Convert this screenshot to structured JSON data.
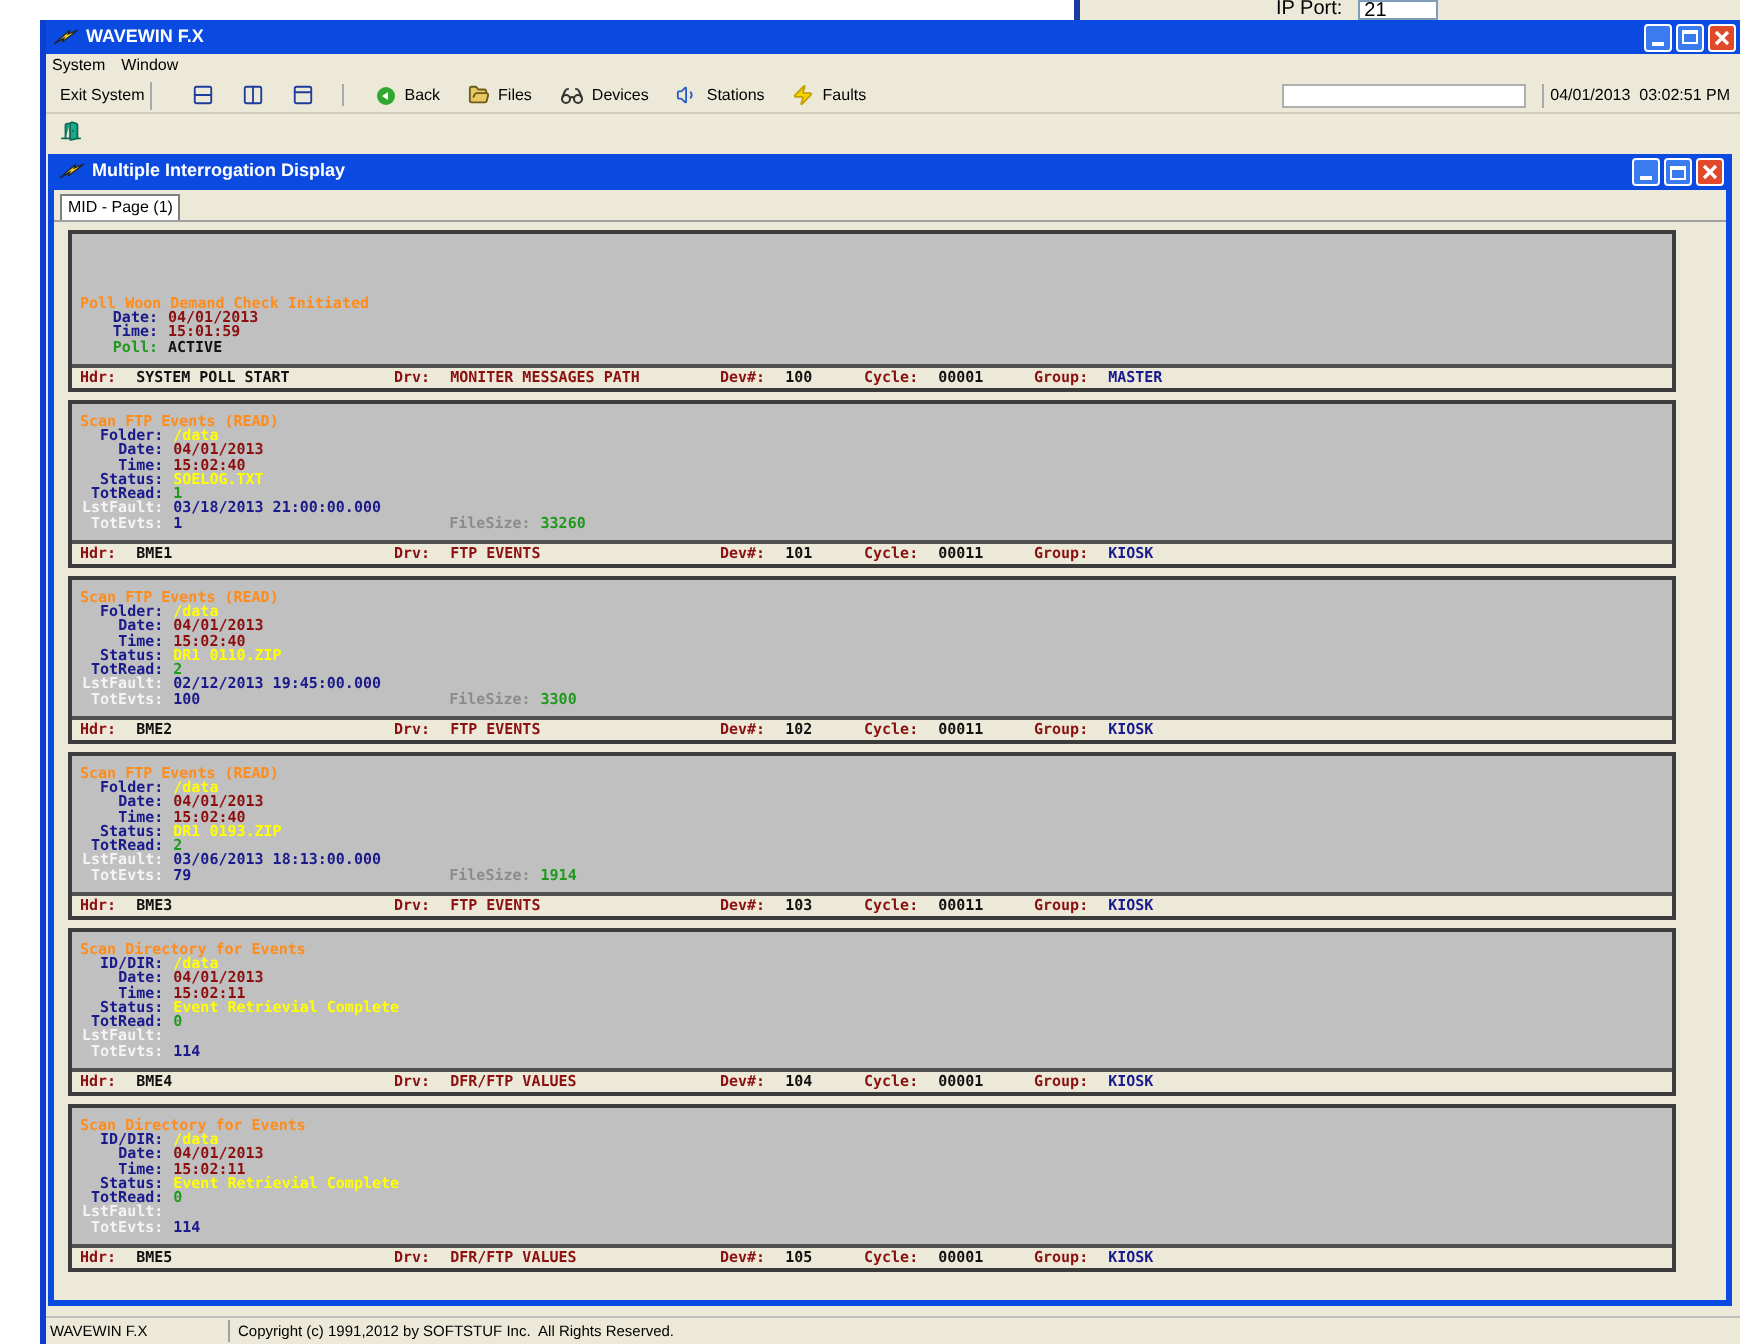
{
  "background_window": {
    "label": "IP Port:",
    "value": "21"
  },
  "window": {
    "title": "WAVEWIN F.X"
  },
  "menu": [
    "System",
    "Window"
  ],
  "toolbar": {
    "exit": "Exit System",
    "nav": [
      {
        "kind": "back",
        "label": "Back"
      },
      {
        "kind": "files",
        "label": "Files"
      },
      {
        "kind": "devices",
        "label": "Devices"
      },
      {
        "kind": "stations",
        "label": "Stations"
      },
      {
        "kind": "faults",
        "label": "Faults"
      }
    ],
    "datetime": "04/01/2013  03:02:51 PM"
  },
  "child_window": {
    "title": "Multiple Interrogation Display",
    "tabs": [
      {
        "label": "MID - Page (1)",
        "selected": true
      }
    ]
  },
  "panels": [
    {
      "title": "Poll Woon Demand Check Initiated",
      "fields": [
        {
          "kind": "timestamp",
          "label": "Date:",
          "value": "04/01/2013"
        },
        {
          "kind": "timestamp",
          "label": "Time:",
          "value": "15:01:59"
        },
        {
          "kind": "poll",
          "label": "Poll:",
          "value": "ACTIVE"
        }
      ],
      "footer": [
        {
          "label": "Hdr:",
          "value": "SYSTEM POLL START"
        },
        {
          "label": "Drv:",
          "value": "MONITER MESSAGES PATH"
        },
        {
          "label": "Dev#:",
          "value": "100"
        },
        {
          "label": "Cycle:",
          "value": "00001"
        },
        {
          "label": "Group:",
          "value": "MASTER"
        }
      ]
    },
    {
      "title": "Scan FTP Events (READ)",
      "fields": [
        {
          "kind": "path",
          "label": "Folder:",
          "value": "/data"
        },
        {
          "kind": "timestamp",
          "label": "Date:",
          "value": "04/01/2013"
        },
        {
          "kind": "timestamp",
          "label": "Time:",
          "value": "15:02:40"
        },
        {
          "kind": "status",
          "label": "Status:",
          "value": "SOELOG.TXT"
        },
        {
          "kind": "read",
          "label": "TotRead:",
          "value": "1"
        },
        {
          "kind": "fault",
          "label": "LstFault:",
          "value": "03/18/2013 21:00:00.000"
        },
        {
          "kind": "events",
          "label": "TotEvts:",
          "value": "1"
        }
      ],
      "file_size": {
        "label": "FileSize:",
        "value": "33260"
      },
      "footer": [
        {
          "label": "Hdr:",
          "value": "BME1"
        },
        {
          "label": "Drv:",
          "value": "FTP EVENTS"
        },
        {
          "label": "Dev#:",
          "value": "101"
        },
        {
          "label": "Cycle:",
          "value": "00011"
        },
        {
          "label": "Group:",
          "value": "KIOSK"
        }
      ]
    },
    {
      "title": "Scan FTP Events (READ)",
      "fields": [
        {
          "kind": "path",
          "label": "Folder:",
          "value": "/data"
        },
        {
          "kind": "timestamp",
          "label": "Date:",
          "value": "04/01/2013"
        },
        {
          "kind": "timestamp",
          "label": "Time:",
          "value": "15:02:40"
        },
        {
          "kind": "status",
          "label": "Status:",
          "value": "DR1 0110.ZIP"
        },
        {
          "kind": "read",
          "label": "TotRead:",
          "value": "2"
        },
        {
          "kind": "fault",
          "label": "LstFault:",
          "value": "02/12/2013 19:45:00.000"
        },
        {
          "kind": "events",
          "label": "TotEvts:",
          "value": "100"
        }
      ],
      "file_size": {
        "label": "FileSize:",
        "value": "3300"
      },
      "footer": [
        {
          "label": "Hdr:",
          "value": "BME2"
        },
        {
          "label": "Drv:",
          "value": "FTP EVENTS"
        },
        {
          "label": "Dev#:",
          "value": "102"
        },
        {
          "label": "Cycle:",
          "value": "00011"
        },
        {
          "label": "Group:",
          "value": "KIOSK"
        }
      ]
    },
    {
      "title": "Scan FTP Events (READ)",
      "fields": [
        {
          "kind": "path",
          "label": "Folder:",
          "value": "/data"
        },
        {
          "kind": "timestamp",
          "label": "Date:",
          "value": "04/01/2013"
        },
        {
          "kind": "timestamp",
          "label": "Time:",
          "value": "15:02:40"
        },
        {
          "kind": "status",
          "label": "Status:",
          "value": "DR1 0193.ZIP"
        },
        {
          "kind": "read",
          "label": "TotRead:",
          "value": "2"
        },
        {
          "kind": "fault",
          "label": "LstFault:",
          "value": "03/06/2013 18:13:00.000"
        },
        {
          "kind": "events",
          "label": "TotEvts:",
          "value": "79"
        }
      ],
      "file_size": {
        "label": "FileSize:",
        "value": "1914"
      },
      "footer": [
        {
          "label": "Hdr:",
          "value": "BME3"
        },
        {
          "label": "Drv:",
          "value": "FTP EVENTS"
        },
        {
          "label": "Dev#:",
          "value": "103"
        },
        {
          "label": "Cycle:",
          "value": "00011"
        },
        {
          "label": "Group:",
          "value": "KIOSK"
        }
      ]
    },
    {
      "title": "Scan Directory for Events",
      "fields": [
        {
          "kind": "path",
          "label": "ID/DIR:",
          "value": "/data"
        },
        {
          "kind": "timestamp",
          "label": "Date:",
          "value": "04/01/2013"
        },
        {
          "kind": "timestamp",
          "label": "Time:",
          "value": "15:02:11"
        },
        {
          "kind": "status",
          "label": "Status:",
          "value": "Event Retrievial Complete"
        },
        {
          "kind": "read",
          "label": "TotRead:",
          "value": "0"
        },
        {
          "kind": "fault",
          "label": "LstFault:"
        },
        {
          "kind": "events",
          "label": "TotEvts:",
          "value": "114"
        }
      ],
      "footer": [
        {
          "label": "Hdr:",
          "value": "BME4"
        },
        {
          "label": "Drv:",
          "value": "DFR/FTP VALUES"
        },
        {
          "label": "Dev#:",
          "value": "104"
        },
        {
          "label": "Cycle:",
          "value": "00001"
        },
        {
          "label": "Group:",
          "value": "KIOSK"
        }
      ]
    },
    {
      "title": "Scan Directory for Events",
      "fields": [
        {
          "kind": "path",
          "label": "ID/DIR:",
          "value": "/data"
        },
        {
          "kind": "timestamp",
          "label": "Date:",
          "value": "04/01/2013"
        },
        {
          "kind": "timestamp",
          "label": "Time:",
          "value": "15:02:11"
        },
        {
          "kind": "status",
          "label": "Status:",
          "value": "Event Retrievial Complete"
        },
        {
          "kind": "read",
          "label": "TotRead:",
          "value": "0"
        },
        {
          "kind": "fault",
          "label": "LstFault:"
        },
        {
          "kind": "events",
          "label": "TotEvts:",
          "value": "114"
        }
      ],
      "footer": [
        {
          "label": "Hdr:",
          "value": "BME5"
        },
        {
          "label": "Drv:",
          "value": "DFR/FTP VALUES"
        },
        {
          "label": "Dev#:",
          "value": "105"
        },
        {
          "label": "Cycle:",
          "value": "00001"
        },
        {
          "label": "Group:",
          "value": "KIOSK"
        }
      ]
    }
  ],
  "status_bar": [
    "WAVEWIN F.X",
    "Copyright (c) 1991,2012 by SOFTSTUF Inc.  All Rights Reserved."
  ]
}
